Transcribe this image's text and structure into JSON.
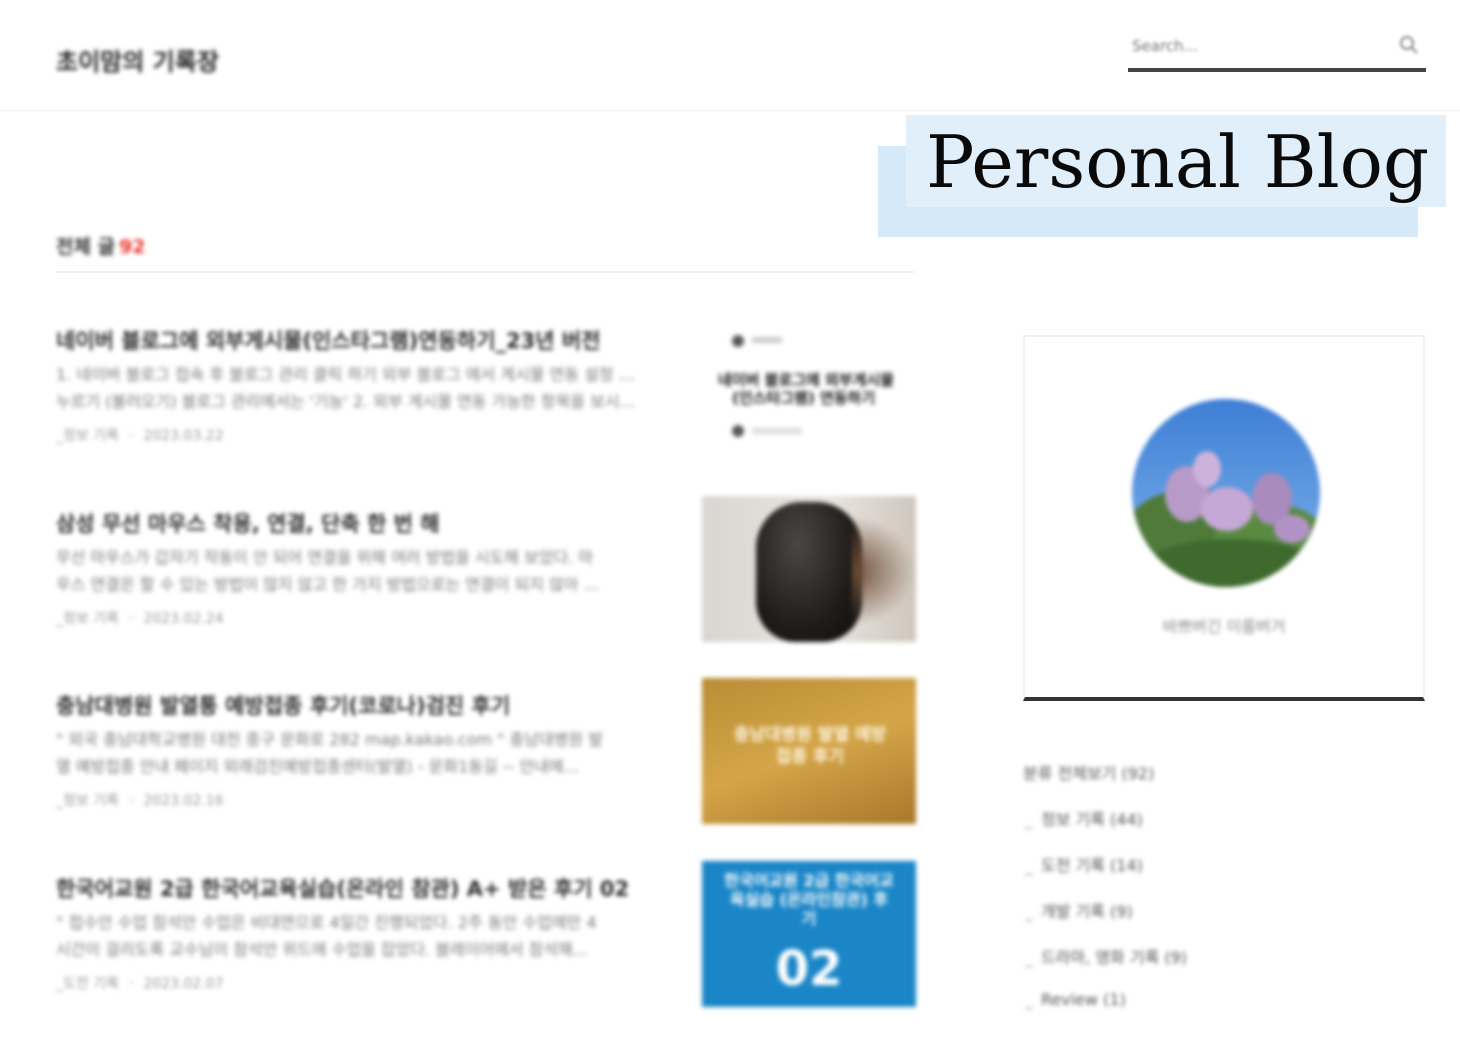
{
  "header": {
    "blog_title": "초이맘의 기록장",
    "search_placeholder": "Search..."
  },
  "overlay": {
    "label": "Personal Blog"
  },
  "section": {
    "title": "전체 글",
    "count": "92"
  },
  "posts": [
    {
      "title": "네이버 블로그에 외부게시물(인스타그램)연동하기_23년 버전",
      "excerpt1": "1. 네이버 블로그 접속 후 블로그 관리 클릭 하기 외부 블로그 에서 게시물 연동 설정 화면",
      "excerpt2": "누르기 (불러오기) 블로그 관리에서는 '기능' 2. 외부 게시물 연동 가능한 항목을 보시...",
      "category": "_정보 기록",
      "date": "2023.03.22"
    },
    {
      "title": "삼성 무선 마우스 착용, 연결, 단축 한 번 해",
      "excerpt1": "무선 마우스가 갑자기 작동이 안 되어 연결을 위해 여러 방법을 시도해 보았다. 마",
      "excerpt2": "우스 연결은 할 수 있는 방법이 많지 않고 한 가지 방법으로는 연결이 되지 않아 ...",
      "category": "_정보 기록",
      "date": "2023.02.24"
    },
    {
      "title": "충남대병원 발열통 예방접종 후기(코로나)검진 후기",
      "excerpt1": "\" 외국 충남대학교병원 대전 중구 문화로 282 map.kakao.com \" 충남대병원 발",
      "excerpt2": "열 예방접종 안내 페이지 외래검진예방접종센터(발열) - 문화1동길 -- 안내에...",
      "category": "_정보 기록",
      "date": "2023.02.16"
    },
    {
      "title": "한국어교원 2급 한국어교육실습(온라인 참관) A+ 받은 후기 02",
      "excerpt1": "\" 접수안 수업 참석안 수업은 비대면으로 4일간 진행되었다. 2주 동안 수업에만 4",
      "excerpt2": "시간이 걸리도록 교수님이 참석안 위드에 수업을 잡았다. 블레이어에서 참석해...",
      "category": "_도전 기록",
      "date": "2023.02.07"
    }
  ],
  "thumb_texts": {
    "post1_line1": "네이버 블로그에 외부게시물",
    "post1_line2": "(인스타그램) 연동하기",
    "post3_label": "충남대병원 발열 예방접종 후기",
    "post4_label": "한국어교원 2급 한국어교육실습 (온라인참관) 후기",
    "post4_number": "02"
  },
  "profile": {
    "name": "바쁘버긴 이룸버거"
  },
  "categories": [
    {
      "label": "분류 전체보기 (92)",
      "sub": false
    },
    {
      "label": "정보 기록 (44)",
      "sub": true
    },
    {
      "label": "도전 기록 (14)",
      "sub": true
    },
    {
      "label": "개발 기록 (9)",
      "sub": true
    },
    {
      "label": "드라마, 영화 기록 (9)",
      "sub": true
    },
    {
      "label": "Review (1)",
      "sub": true
    }
  ],
  "colors": {
    "accent_count": "#e8362f",
    "overlay_bg": "#e0effa",
    "thumb_blue": "#1a86c7"
  }
}
